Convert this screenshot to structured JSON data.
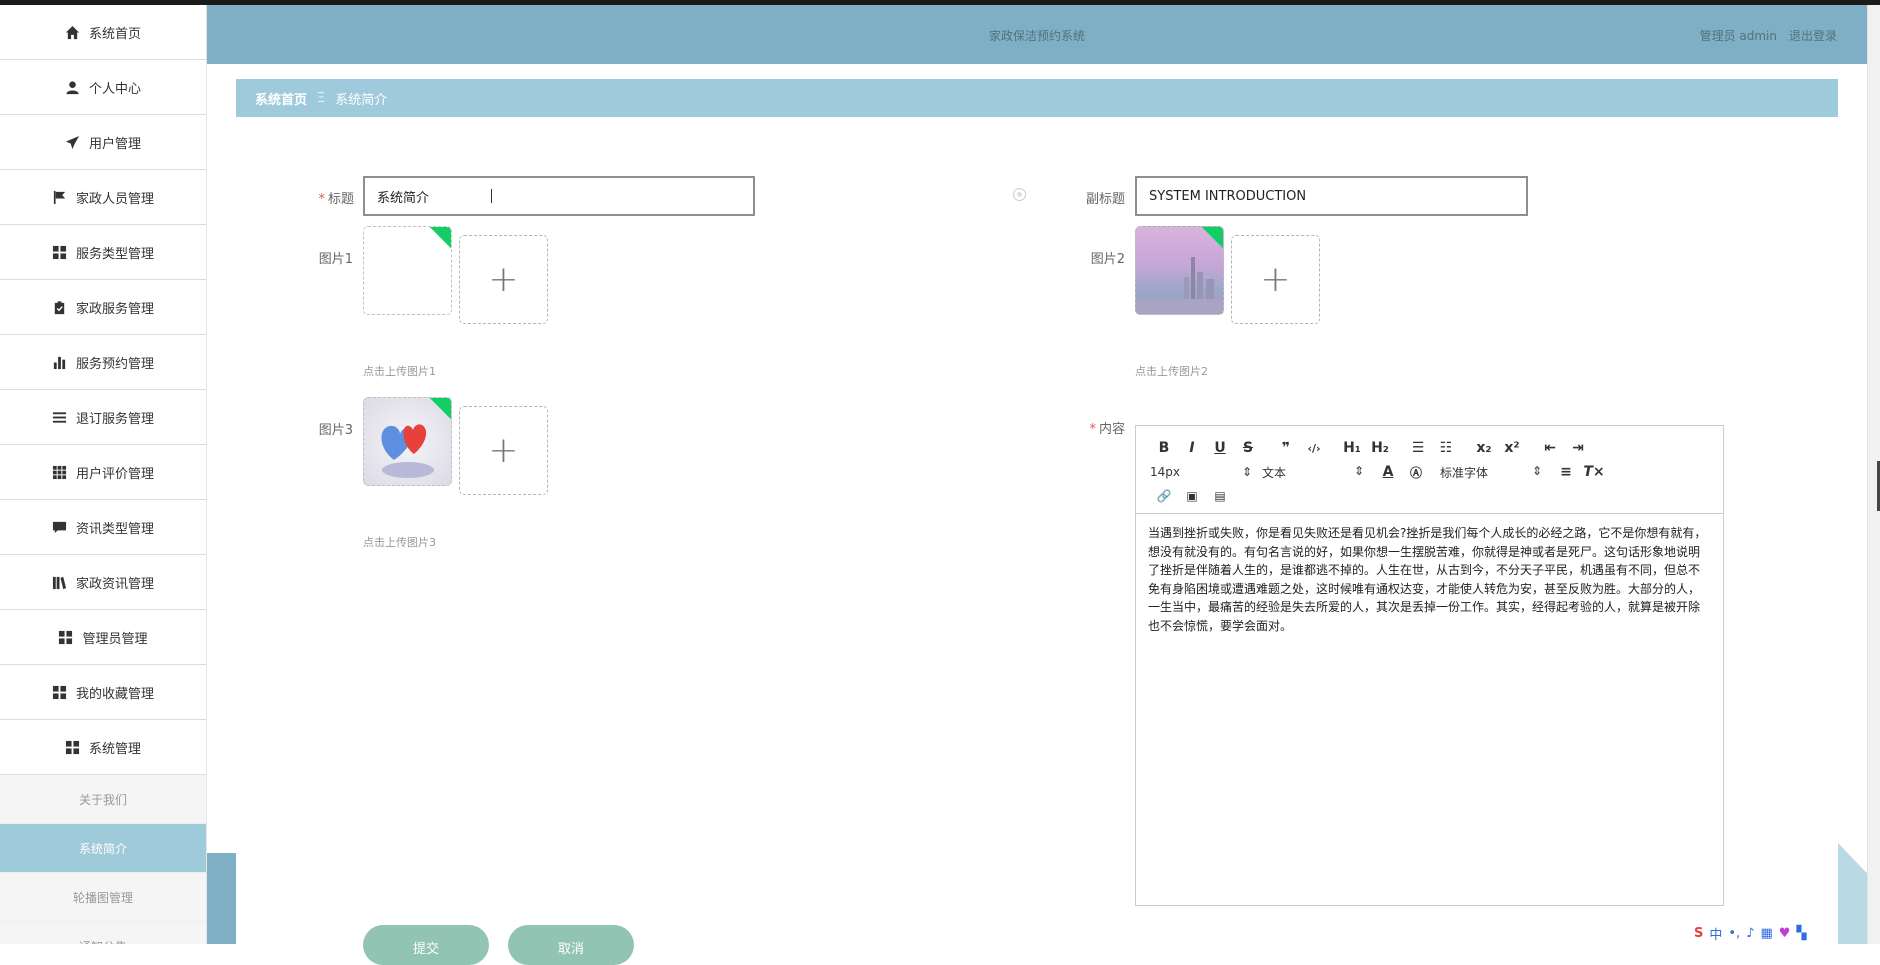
{
  "header": {
    "title": "家政保洁预约系统",
    "user": "管理员 admin",
    "logout": "退出登录"
  },
  "sidebar": {
    "items": [
      {
        "label": "系统首页",
        "icon": "home-icon"
      },
      {
        "label": "个人中心",
        "icon": "user-icon"
      },
      {
        "label": "用户管理",
        "icon": "paper-plane-icon"
      },
      {
        "label": "家政人员管理",
        "icon": "flag-icon"
      },
      {
        "label": "服务类型管理",
        "icon": "grid-icon"
      },
      {
        "label": "家政服务管理",
        "icon": "clipboard-icon"
      },
      {
        "label": "服务预约管理",
        "icon": "bar-chart-icon"
      },
      {
        "label": "退订服务管理",
        "icon": "list-icon"
      },
      {
        "label": "用户评价管理",
        "icon": "grid-icon"
      },
      {
        "label": "资讯类型管理",
        "icon": "comment-icon"
      },
      {
        "label": "家政资讯管理",
        "icon": "library-icon"
      },
      {
        "label": "管理员管理",
        "icon": "grid-icon"
      },
      {
        "label": "我的收藏管理",
        "icon": "grid-icon"
      },
      {
        "label": "系统管理",
        "icon": "grid-icon"
      }
    ],
    "sub_items": [
      {
        "label": "关于我们",
        "active": false
      },
      {
        "label": "系统简介",
        "active": true
      },
      {
        "label": "轮播图管理",
        "active": false
      },
      {
        "label": "通知公告",
        "active": false
      }
    ]
  },
  "breadcrumb": {
    "home": "系统首页",
    "separator": "Ξ",
    "current": "系统简介"
  },
  "form": {
    "title_label": "标题",
    "title_value": "系统简介",
    "subtitle_label": "副标题",
    "subtitle_value": "SYSTEM INTRODUCTION",
    "image1_label": "图片1",
    "image1_hint": "点击上传图片1",
    "image2_label": "图片2",
    "image2_hint": "点击上传图片2",
    "image3_label": "图片3",
    "image3_hint": "点击上传图片3",
    "content_label": "内容",
    "required_mark": "*"
  },
  "editor": {
    "font_size": "14px",
    "text_type": "文本",
    "font_family": "标准字体",
    "content": "当遇到挫折或失败，你是看见失败还是看见机会?挫折是我们每个人成长的必经之路，它不是你想有就有，想没有就没有的。有句名言说的好，如果你想一生摆脱苦难，你就得是神或者是死尸。这句话形象地说明了挫折是伴随着人生的，是谁都逃不掉的。人生在世，从古到今，不分天子平民，机遇虽有不同，但总不免有身陷困境或遭遇难题之处，这时候唯有通权达变，才能使人转危为安，甚至反败为胜。大部分的人，一生当中，最痛苦的经验是失去所爱的人，其次是丢掉一份工作。其实，经得起考验的人，就算是被开除也不会惊慌，要学会面对。"
  },
  "buttons": {
    "submit": "提交",
    "cancel": "取消"
  },
  "colors": {
    "header": "#7eafc4",
    "breadcrumb": "#9fcadb",
    "active_sub": "#9fcad9",
    "button": "#92c4b3",
    "upload_badge": "#13ce66"
  }
}
